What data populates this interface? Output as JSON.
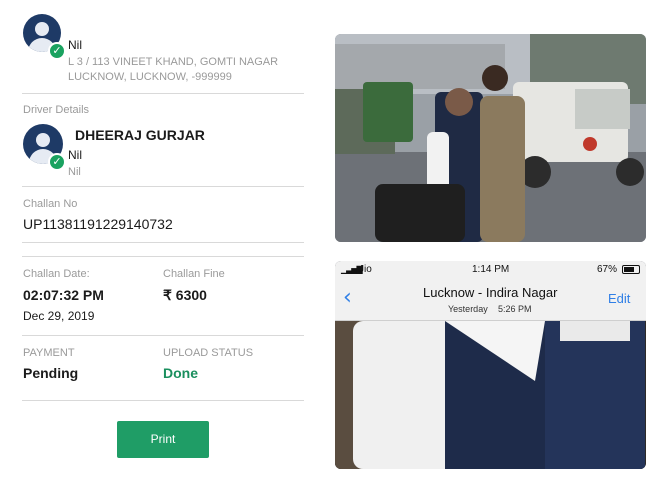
{
  "owner": {
    "name": "Nil",
    "address_line1": "L 3 / 113 VINEET KHAND, GOMTI NAGAR",
    "address_line2": "LUCKNOW, LUCKNOW, -999999"
  },
  "driver_section_label": "Driver Details",
  "driver": {
    "name": "DHEERAJ GURJAR",
    "line1": "Nil",
    "line2": "Nil"
  },
  "challan_no_label": "Challan No",
  "challan_no": "UP11381191229140732",
  "challan_date_label": "Challan Date:",
  "challan_time": "02:07:32 PM",
  "challan_date": "Dec 29, 2019",
  "challan_fine_label": "Challan Fine",
  "challan_fine": "₹ 6300",
  "payment_label": "PAYMENT",
  "payment_status": "Pending",
  "upload_label": "UPLOAD STATUS",
  "upload_status": "Done",
  "print_label": "Print",
  "phone": {
    "carrier": "Jio",
    "time": "1:14 PM",
    "battery": "67%",
    "title": "Lucknow - Indira Nagar",
    "subtitle_day": "Yesterday",
    "subtitle_time": "5:26 PM",
    "edit_label": "Edit"
  },
  "colors": {
    "accent_green": "#1f9d66",
    "done_green": "#1a8f5e",
    "ios_blue": "#2f7fe6"
  },
  "icons": [
    "verified-check-icon",
    "avatar-icon",
    "back-chevron-icon",
    "signal-icon",
    "battery-icon"
  ]
}
